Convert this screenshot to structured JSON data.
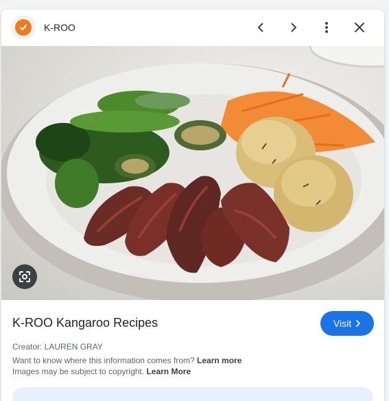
{
  "header": {
    "site_name": "K-ROO",
    "logo_icon": "check-circle-icon",
    "brand_color": "#f07a1a",
    "actions": [
      "chevron-left-icon",
      "chevron-right-icon",
      "more-vert-icon",
      "close-icon"
    ]
  },
  "image": {
    "subject_icon": "food-photo",
    "lens_icon": "google-lens-icon"
  },
  "result": {
    "title": "K-ROO Kangaroo Recipes",
    "visit_label": "Visit",
    "visit_color": "#1a73e8",
    "creator": "Creator: LAUREN GRAY",
    "info_line1_prefix": "Want to know where this information comes from?",
    "info_line1_link": "Learn more",
    "info_line2_prefix": "Images may be subject to copyright.",
    "info_line2_link": "Learn More"
  }
}
